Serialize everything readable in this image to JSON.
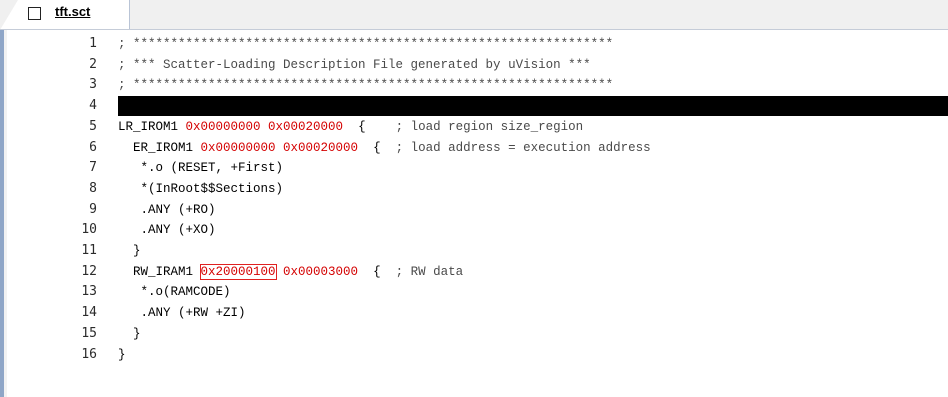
{
  "tab": {
    "title": "tft.sct"
  },
  "colors": {
    "hex_literal": "#d40000",
    "highlight_box": "#e02020",
    "comment": "#4a4a4a"
  },
  "lines": [
    {
      "num": "1",
      "segments": [
        {
          "t": "; ",
          "c": "comment"
        },
        {
          "t": "****************************************************************",
          "c": "comment"
        }
      ]
    },
    {
      "num": "2",
      "segments": [
        {
          "t": "; *** Scatter-Loading Description File generated by uVision ***",
          "c": "comment"
        }
      ]
    },
    {
      "num": "3",
      "segments": [
        {
          "t": "; ",
          "c": "comment"
        },
        {
          "t": "****************************************************************",
          "c": "comment"
        }
      ]
    },
    {
      "num": "4",
      "redacted": true,
      "segments": []
    },
    {
      "num": "5",
      "segments": [
        {
          "t": "LR_IROM1 ",
          "c": ""
        },
        {
          "t": "0x00000000",
          "c": "hex"
        },
        {
          "t": " ",
          "c": ""
        },
        {
          "t": "0x00020000",
          "c": "hex"
        },
        {
          "t": "  {    ",
          "c": ""
        },
        {
          "t": "; load region size_region",
          "c": "comment"
        }
      ]
    },
    {
      "num": "6",
      "segments": [
        {
          "t": "  ER_IROM1 ",
          "c": ""
        },
        {
          "t": "0x00000000",
          "c": "hex"
        },
        {
          "t": " ",
          "c": ""
        },
        {
          "t": "0x00020000",
          "c": "hex"
        },
        {
          "t": "  {  ",
          "c": ""
        },
        {
          "t": "; load address = execution address",
          "c": "comment"
        }
      ]
    },
    {
      "num": "7",
      "segments": [
        {
          "t": "   *.o (RESET, +First)",
          "c": ""
        }
      ]
    },
    {
      "num": "8",
      "segments": [
        {
          "t": "   *(InRoot$$Sections)",
          "c": ""
        }
      ]
    },
    {
      "num": "9",
      "segments": [
        {
          "t": "   .ANY (+RO)",
          "c": ""
        }
      ]
    },
    {
      "num": "10",
      "segments": [
        {
          "t": "   .ANY (+XO)",
          "c": ""
        }
      ]
    },
    {
      "num": "11",
      "segments": [
        {
          "t": "  }",
          "c": ""
        }
      ]
    },
    {
      "num": "12",
      "segments": [
        {
          "t": "  RW_IRAM1 ",
          "c": ""
        },
        {
          "t": "0x20000100",
          "c": "hex boxed"
        },
        {
          "t": " ",
          "c": ""
        },
        {
          "t": "0x00003000",
          "c": "hex"
        },
        {
          "t": "  {  ",
          "c": ""
        },
        {
          "t": "; RW data",
          "c": "comment"
        }
      ]
    },
    {
      "num": "13",
      "segments": [
        {
          "t": "   *.o(RAMCODE)",
          "c": ""
        }
      ]
    },
    {
      "num": "14",
      "segments": [
        {
          "t": "   .ANY (+RW +ZI)",
          "c": ""
        }
      ]
    },
    {
      "num": "15",
      "segments": [
        {
          "t": "  }",
          "c": ""
        }
      ]
    },
    {
      "num": "16",
      "segments": [
        {
          "t": "}",
          "c": ""
        }
      ]
    }
  ]
}
